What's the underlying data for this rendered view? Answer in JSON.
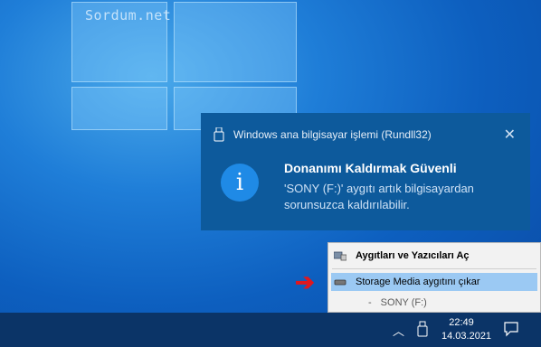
{
  "watermark": "Sordum.net",
  "toast": {
    "app_name": "Windows ana bilgisayar işlemi (Rundll32)",
    "close_glyph": "✕",
    "info_glyph": "i",
    "title": "Donanımı Kaldırmak Güvenli",
    "message": "'SONY (F:)' aygıtı artık bilgisayardan sorunsuzca kaldırılabilir."
  },
  "menu": {
    "items": [
      {
        "label": "Aygıtları ve Yazıcıları Aç",
        "icon": "devices-printers-icon"
      },
      {
        "label": "Storage Media aygıtını çıkar",
        "icon": "drive-icon"
      },
      {
        "label": "SONY (F:)",
        "prefix": "-"
      }
    ]
  },
  "arrow_glyph": "➔",
  "taskbar": {
    "chevron_glyph": "︿",
    "time": "22:49",
    "date": "14.03.2021"
  },
  "colors": {
    "accent_blue": "#1f8ae6",
    "toast_bg": "#0d5a9c",
    "menu_highlight": "#9bc9f3",
    "arrow_red": "#e0171f"
  }
}
